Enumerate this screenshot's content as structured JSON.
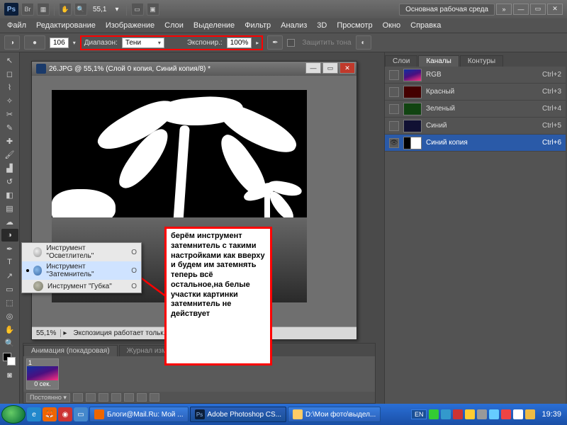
{
  "titlebar": {
    "logo": "Ps",
    "zoom_field": "55,1",
    "workspace_button": "Основная рабочая среда",
    "expand": "»"
  },
  "menubar": {
    "items": [
      "Файл",
      "Редактирование",
      "Изображение",
      "Слои",
      "Выделение",
      "Фильтр",
      "Анализ",
      "3D",
      "Просмотр",
      "Окно",
      "Справка"
    ]
  },
  "options": {
    "brush_size": "106",
    "range_label": "Диапазон:",
    "range_value": "Тени",
    "exposure_label": "Экспонир.:",
    "exposure_value": "100%",
    "protect_label": "Защитить тона"
  },
  "doc": {
    "title": "26.JPG @ 55,1% (Слой 0 копия, Синий копия/8) *",
    "zoom": "55,1%",
    "status": "Экспозиция работает тольк..."
  },
  "flyout": {
    "items": [
      {
        "label": "Инструмент \"Осветлитель\"",
        "key": "O"
      },
      {
        "label": "Инструмент \"Затемнитель\"",
        "key": "O"
      },
      {
        "label": "Инструмент \"Губка\"",
        "key": "O"
      }
    ]
  },
  "annotation": "берём инструмент затемнитель с такими настройками как вверху и будем им затемнять теперь всё остальное,на белые участки картинки затемнитель не действует",
  "anim": {
    "tab1": "Анимация (покадровая)",
    "tab2": "Журнал измерений",
    "frame_num": "1",
    "frame_time": "0 сек.",
    "loop": "Постоянно"
  },
  "channels": {
    "tabs": [
      "Слои",
      "Каналы",
      "Контуры"
    ],
    "rows": [
      {
        "name": "RGB",
        "shortcut": "Ctrl+2",
        "thumb": "rgb",
        "eye": false
      },
      {
        "name": "Красный",
        "shortcut": "Ctrl+3",
        "thumb": "r",
        "eye": false
      },
      {
        "name": "Зеленый",
        "shortcut": "Ctrl+4",
        "thumb": "g",
        "eye": false
      },
      {
        "name": "Синий",
        "shortcut": "Ctrl+5",
        "thumb": "b",
        "eye": false
      },
      {
        "name": "Синий копия",
        "shortcut": "Ctrl+6",
        "thumb": "bw",
        "eye": true,
        "selected": true
      }
    ]
  },
  "taskbar": {
    "tasks": [
      {
        "label": "Блоги@Mail.Ru: Мой ..."
      },
      {
        "label": "Adobe Photoshop CS...",
        "active": true
      },
      {
        "label": "D:\\Мои фото\\выдел..."
      }
    ],
    "lang": "EN",
    "clock": "19:39"
  }
}
